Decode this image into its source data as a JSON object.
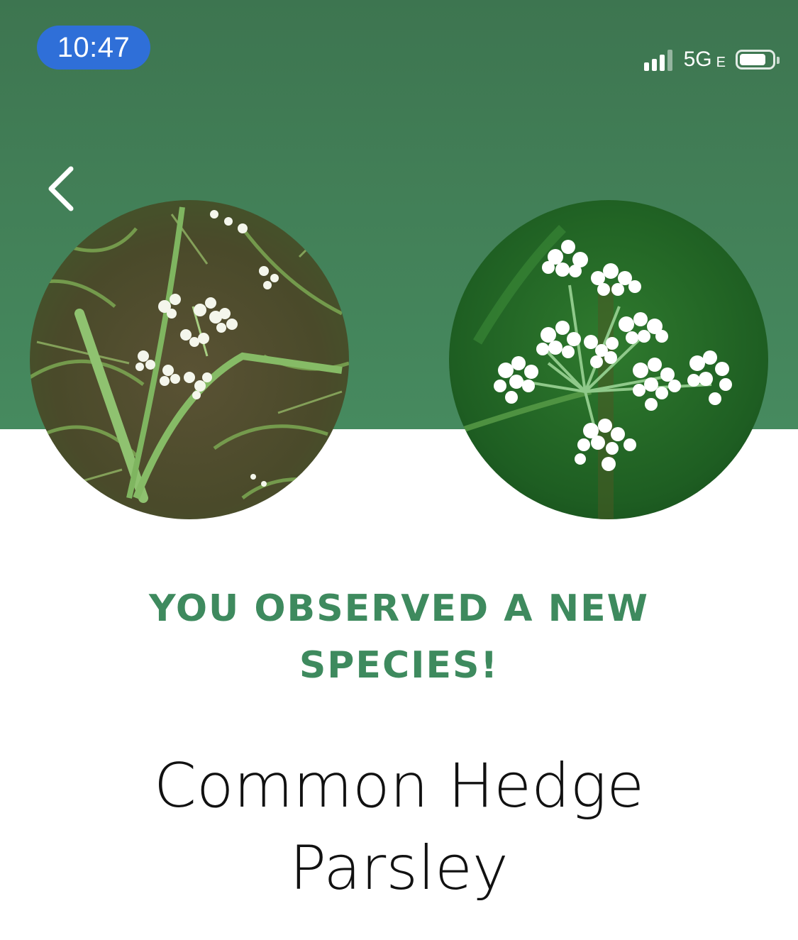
{
  "status_bar": {
    "time": "10:47",
    "network": "5G",
    "network_suffix": "E",
    "signal_icon": "cellular-signal-icon",
    "battery_icon": "battery-icon",
    "time_pill_color": "#2f6fd8"
  },
  "nav": {
    "back_icon": "chevron-left-icon"
  },
  "photos": {
    "user_photo_icon": "observation-photo",
    "reference_photo_icon": "species-reference-photo"
  },
  "headline": {
    "line1": "YOU OBSERVED A NEW",
    "line2": "SPECIES!",
    "color": "#3e8a5e"
  },
  "species": {
    "name_line1": "Common Hedge",
    "name_line2": "Parsley"
  },
  "colors": {
    "header_green": "#427f57",
    "background": "#ffffff",
    "name_text": "#111111"
  }
}
